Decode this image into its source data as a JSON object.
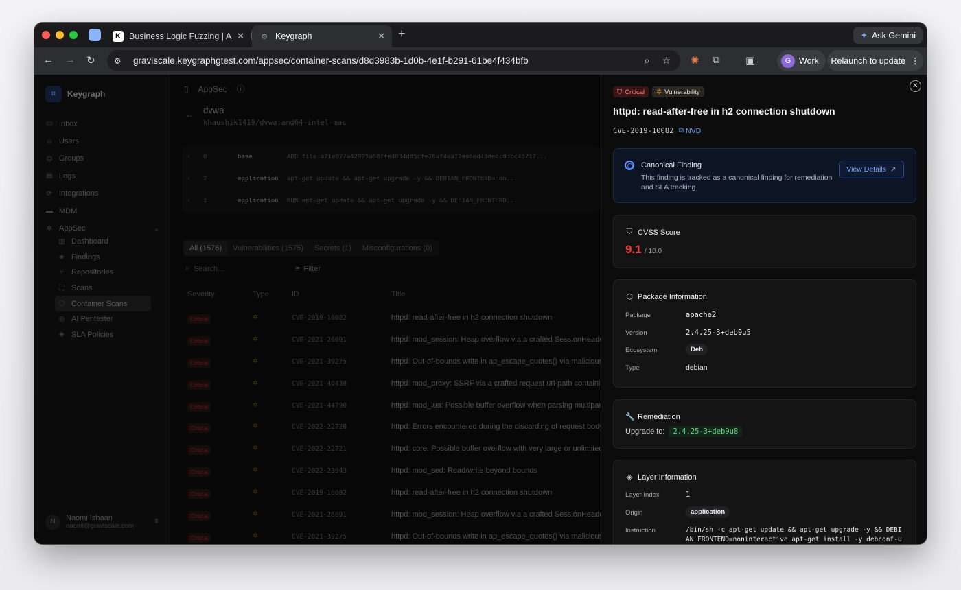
{
  "browser": {
    "tabs": [
      {
        "title": "Business Logic Fuzzing | Auth",
        "favicon": "K"
      },
      {
        "title": "Keygraph",
        "favicon": "gear"
      }
    ],
    "ask_gemini": "Ask Gemini",
    "url": "graviscale.keygraphgtest.com/appsec/container-scans/d8d3983b-1d0b-4e1f-b291-61be4f434bfb",
    "profile_initial": "G",
    "profile_label": "Work",
    "relaunch_label": "Relaunch to update"
  },
  "sidebar": {
    "brand": "Keygraph",
    "items": [
      {
        "label": "Inbox",
        "icon": "inbox-icon"
      },
      {
        "label": "Users",
        "icon": "users-icon"
      },
      {
        "label": "Groups",
        "icon": "groups-icon"
      },
      {
        "label": "Logs",
        "icon": "logs-icon"
      },
      {
        "label": "Integrations",
        "icon": "integrations-icon"
      },
      {
        "label": "MDM",
        "icon": "mdm-icon"
      },
      {
        "label": "AppSec",
        "icon": "appsec-icon"
      }
    ],
    "subitems": [
      {
        "label": "Dashboard"
      },
      {
        "label": "Findings"
      },
      {
        "label": "Repositories"
      },
      {
        "label": "Scans"
      },
      {
        "label": "Container Scans"
      },
      {
        "label": "AI Pentester"
      },
      {
        "label": "SLA Policies"
      }
    ],
    "user": {
      "initial": "N",
      "name": "Naomi Ishaan",
      "email": "naomi@graviscale.com"
    }
  },
  "main": {
    "section": "AppSec",
    "image_name": "dvwa",
    "image_ref": "khaushik1419/dvwa:amd64-intel-mac",
    "layers": [
      {
        "index": "0",
        "origin": "base",
        "command": "ADD file:a71e077a42995a68ffe4834d85cfe26af4ea12aa8ed43decc03cc48712..."
      },
      {
        "index": "2",
        "origin": "application",
        "command": "apt-get update && apt-get upgrade -y && DEBIAN_FRONTEND=non..."
      },
      {
        "index": "1",
        "origin": "application",
        "command": "RUN apt-get update && apt-get upgrade -y && DEBIAN_FRONTEND..."
      }
    ],
    "filter_tabs": [
      "All (1576)",
      "Vulnerabilities (1575)",
      "Secrets (1)",
      "Misconfigurations (0)"
    ],
    "search_placeholder": "Search...",
    "filter_label": "Filter",
    "columns": [
      "Severity",
      "Type",
      "ID",
      "Title"
    ],
    "rows": [
      {
        "severity": "Critical",
        "id": "CVE-2019-10082",
        "title": "httpd: read-after-free in h2 connection shutdown"
      },
      {
        "severity": "Critical",
        "id": "CVE-2021-26691",
        "title": "httpd: mod_session: Heap overflow via a crafted SessionHeader v"
      },
      {
        "severity": "Critical",
        "id": "CVE-2021-39275",
        "title": "httpd: Out-of-bounds write in ap_escape_quotes() via malicious i"
      },
      {
        "severity": "Critical",
        "id": "CVE-2021-40438",
        "title": "httpd: mod_proxy: SSRF via a crafted request uri-path containing"
      },
      {
        "severity": "Critical",
        "id": "CVE-2021-44790",
        "title": "httpd: mod_lua: Possible buffer overflow when parsing multipart c"
      },
      {
        "severity": "Critical",
        "id": "CVE-2022-22720",
        "title": "httpd: Errors encountered during the discarding of request body l"
      },
      {
        "severity": "Critical",
        "id": "CVE-2022-22721",
        "title": "httpd: core: Possible buffer overflow with very large or unlimited l"
      },
      {
        "severity": "Critical",
        "id": "CVE-2022-23943",
        "title": "httpd: mod_sed: Read/write beyond bounds"
      },
      {
        "severity": "Critical",
        "id": "CVE-2019-10082",
        "title": "httpd: read-after-free in h2 connection shutdown"
      },
      {
        "severity": "Critical",
        "id": "CVE-2021-26691",
        "title": "httpd: mod_session: Heap overflow via a crafted SessionHeader v"
      },
      {
        "severity": "Critical",
        "id": "CVE-2021-39275",
        "title": "httpd: Out-of-bounds write in ap_escape_quotes() via malicious i"
      }
    ]
  },
  "panel": {
    "badge_severity": "Critical",
    "badge_type": "Vulnerability",
    "title": "httpd: read-after-free in h2 connection shutdown",
    "cve_id": "CVE-2019-10082",
    "nvd_label": "NVD",
    "canonical": {
      "title": "Canonical Finding",
      "description": "This finding is tracked as a canonical finding for remediation and SLA tracking.",
      "button": "View Details"
    },
    "cvss": {
      "title": "CVSS Score",
      "score": "9.1",
      "max": "/ 10.0"
    },
    "package": {
      "title": "Package Information",
      "package_label": "Package",
      "package_value": "apache2",
      "version_label": "Version",
      "version_value": "2.4.25-3+deb9u5",
      "ecosystem_label": "Ecosystem",
      "ecosystem_value": "Deb",
      "type_label": "Type",
      "type_value": "debian"
    },
    "remediation": {
      "title": "Remediation",
      "upgrade_label": "Upgrade to:",
      "upgrade_value": "2.4.25-3+deb9u8"
    },
    "layer": {
      "title": "Layer Information",
      "index_label": "Layer Index",
      "index_value": "1",
      "origin_label": "Origin",
      "origin_value": "application",
      "instruction_label": "Instruction",
      "instruction_value": "/bin/sh -c apt-get update && apt-get upgrade -y && DEBIAN_FRONTEND=noninteractive apt-get install -y debconf-utils && echo m"
    }
  },
  "colors": {
    "accent": "#5d8dff",
    "critical": "#ef3b3b",
    "success": "#5fd17d"
  }
}
